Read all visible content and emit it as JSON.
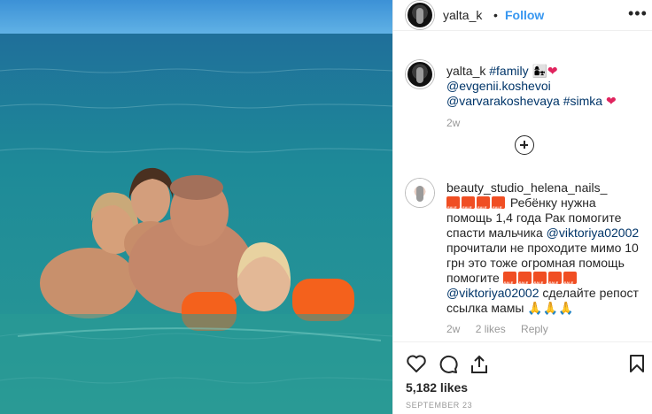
{
  "post": {
    "author": "yalta_k",
    "dot": "•",
    "follow_label": "Follow",
    "more_label": "•••",
    "caption": {
      "author": "yalta_k",
      "tag_family": "#family",
      "emoji_family": "👩‍👧❤",
      "mention1": "@evgenii.koshevoi",
      "mention2": "@varvarakoshevaya",
      "tag_simka": "#simka",
      "heart": "❤",
      "time": "2w"
    },
    "comment": {
      "author": "beauty_studio_helena_nails_",
      "text1": "Ребёнку нужна помощь 1,4 года Рак помогите спасти мальчика",
      "mention": "@viktoriya02002",
      "text2": "прочитали не проходите мимо 10 грн это тоже огромная помощь помогите",
      "mention_again": "@viktoriya02002",
      "text3": "сделайте репост ссылка мамы",
      "pray": "🙏🙏🙏",
      "time": "2w",
      "likes": "2 likes",
      "reply": "Reply"
    },
    "likes": "5,182 likes",
    "date": "SEPTEMBER 23"
  },
  "colors": {
    "accent": "#3897f0",
    "link": "#003569",
    "sea": "#1f8f97",
    "sky": "#4fa3d9",
    "sale_badge": "#f04e23"
  },
  "icons": {
    "like": "heart-outline-icon",
    "comment": "comment-bubble-icon",
    "share": "share-arrow-icon",
    "save": "bookmark-icon",
    "add": "plus-circle-icon",
    "more": "ellipsis-icon"
  }
}
